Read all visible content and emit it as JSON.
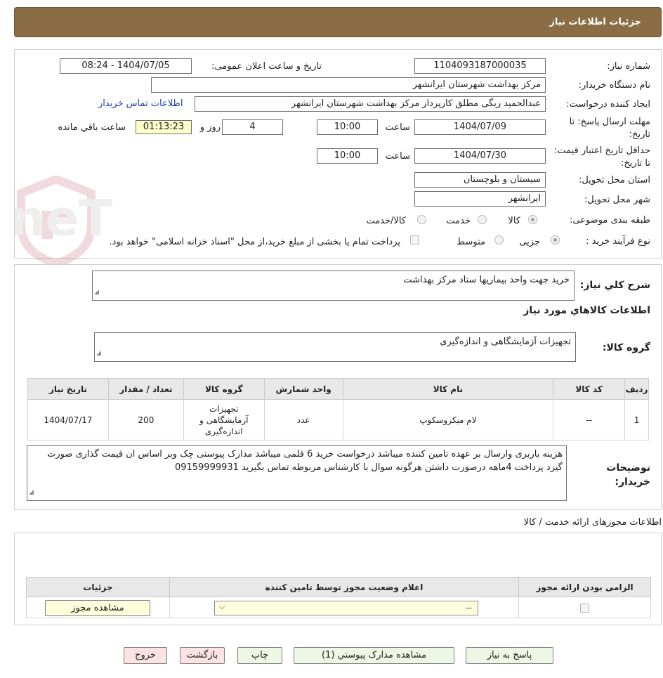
{
  "header": {
    "title": "جزئيات اطلاعات نياز"
  },
  "form": {
    "need_number_label": "شماره نیاز:",
    "need_number": "1104093187000035",
    "announce_label": "تاریخ و ساعت اعلان عمومی:",
    "announce_value": "1404/07/05 - 08:24",
    "buyer_org_label": "نام دستگاه خریدار:",
    "buyer_org": "مرکز بهداشت شهرستان ایرانشهر",
    "creator_label": "ایجاد کننده درخواست:",
    "creator": "عبدالحمید ریگی مطلق کارپرداز مرکز بهداشت شهرستان ایرانشهر",
    "contact_link": "اطلاعات تماس خریدار",
    "deadline_label": "مهلت ارسال پاسخ: تا تاریخ:",
    "deadline_date": "1404/07/09",
    "time_label": "ساعت",
    "deadline_time": "10:00",
    "days_value": "4",
    "days_label": "روز و",
    "countdown": "01:13:23",
    "remaining_label": "ساعت باقي مانده",
    "validity_label": "حداقل تاریخ اعتبار قیمت: تا تاریخ:",
    "validity_date": "1404/07/30",
    "validity_time_label": "ساعت",
    "validity_time": "10:00",
    "province_label": "استان محل تحویل:",
    "province": "سیستان و بلوچستان",
    "city_label": "شهر محل تحویل:",
    "city": "ایرانشهر",
    "category_label": "طبقه بندی موضوعی:",
    "category_options": [
      "کالا",
      "خدمت",
      "کالا/خدمت"
    ],
    "process_label": "نوع فرآیند خرید :",
    "process_options": [
      "جزیی",
      "متوسط"
    ],
    "payment_note": "پرداخت تمام یا بخشی از مبلغ خرید،از محل \"اسناد خزانه اسلامی\" خواهد بود."
  },
  "watermark": {
    "text": "AriaTender.neT"
  },
  "description": {
    "label": "شرح کلي نياز:",
    "value": "خرید جهت واحد بیماریها ستاد مرکز بهداشت"
  },
  "goods_section": {
    "title": "اطلاعات کالاهاي مورد نياز",
    "group_label": "گروه کالا:",
    "group_value": "تجهیزات آزمایشگاهی و اندازه‌گیری"
  },
  "goods_table": {
    "headers": [
      "رديف",
      "کد کالا",
      "نام کالا",
      "واحد شمارش",
      "گروه کالا",
      "تعداد / مقدار",
      "تاریخ نیاز"
    ],
    "rows": [
      {
        "row": "1",
        "code": "--",
        "name": "لام میکروسکوپ",
        "unit": "عدد",
        "group": "تجهیزات آزمایشگاهی و اندازه‌گیری",
        "qty": "200",
        "date": "1404/07/17"
      }
    ]
  },
  "buyer_notes": {
    "label": "توضیحات خریدار:",
    "value": "هزینه باربری وارسال بر عهده تامین کننده میباشد  درخواست خرید 6 قلمی میباشد مدارک پیوستی چک وبر اساس ان قیمت گذاری صورت گیرد پرداخت 4ماهه درصورت داشتن هرگونه سوال با کارشناس مربوطه تماس بگیرید 09159999931"
  },
  "permits": {
    "title": "اطلاعات مجوزهای ارائه خدمت / کالا",
    "headers": [
      "الزامی بودن ارائه مجوز",
      "اعلام وضعیت مجوز توسط تامین کننده",
      "جزئیات"
    ],
    "select_value": "--",
    "view_button": "مشاهده مجوز"
  },
  "buttons": {
    "reply": "پاسخ به نیاز",
    "attachments": "مشاهده مدارک پیوستي (1)",
    "print": "چاپ",
    "back": "بازگشت",
    "exit": "خروج"
  }
}
